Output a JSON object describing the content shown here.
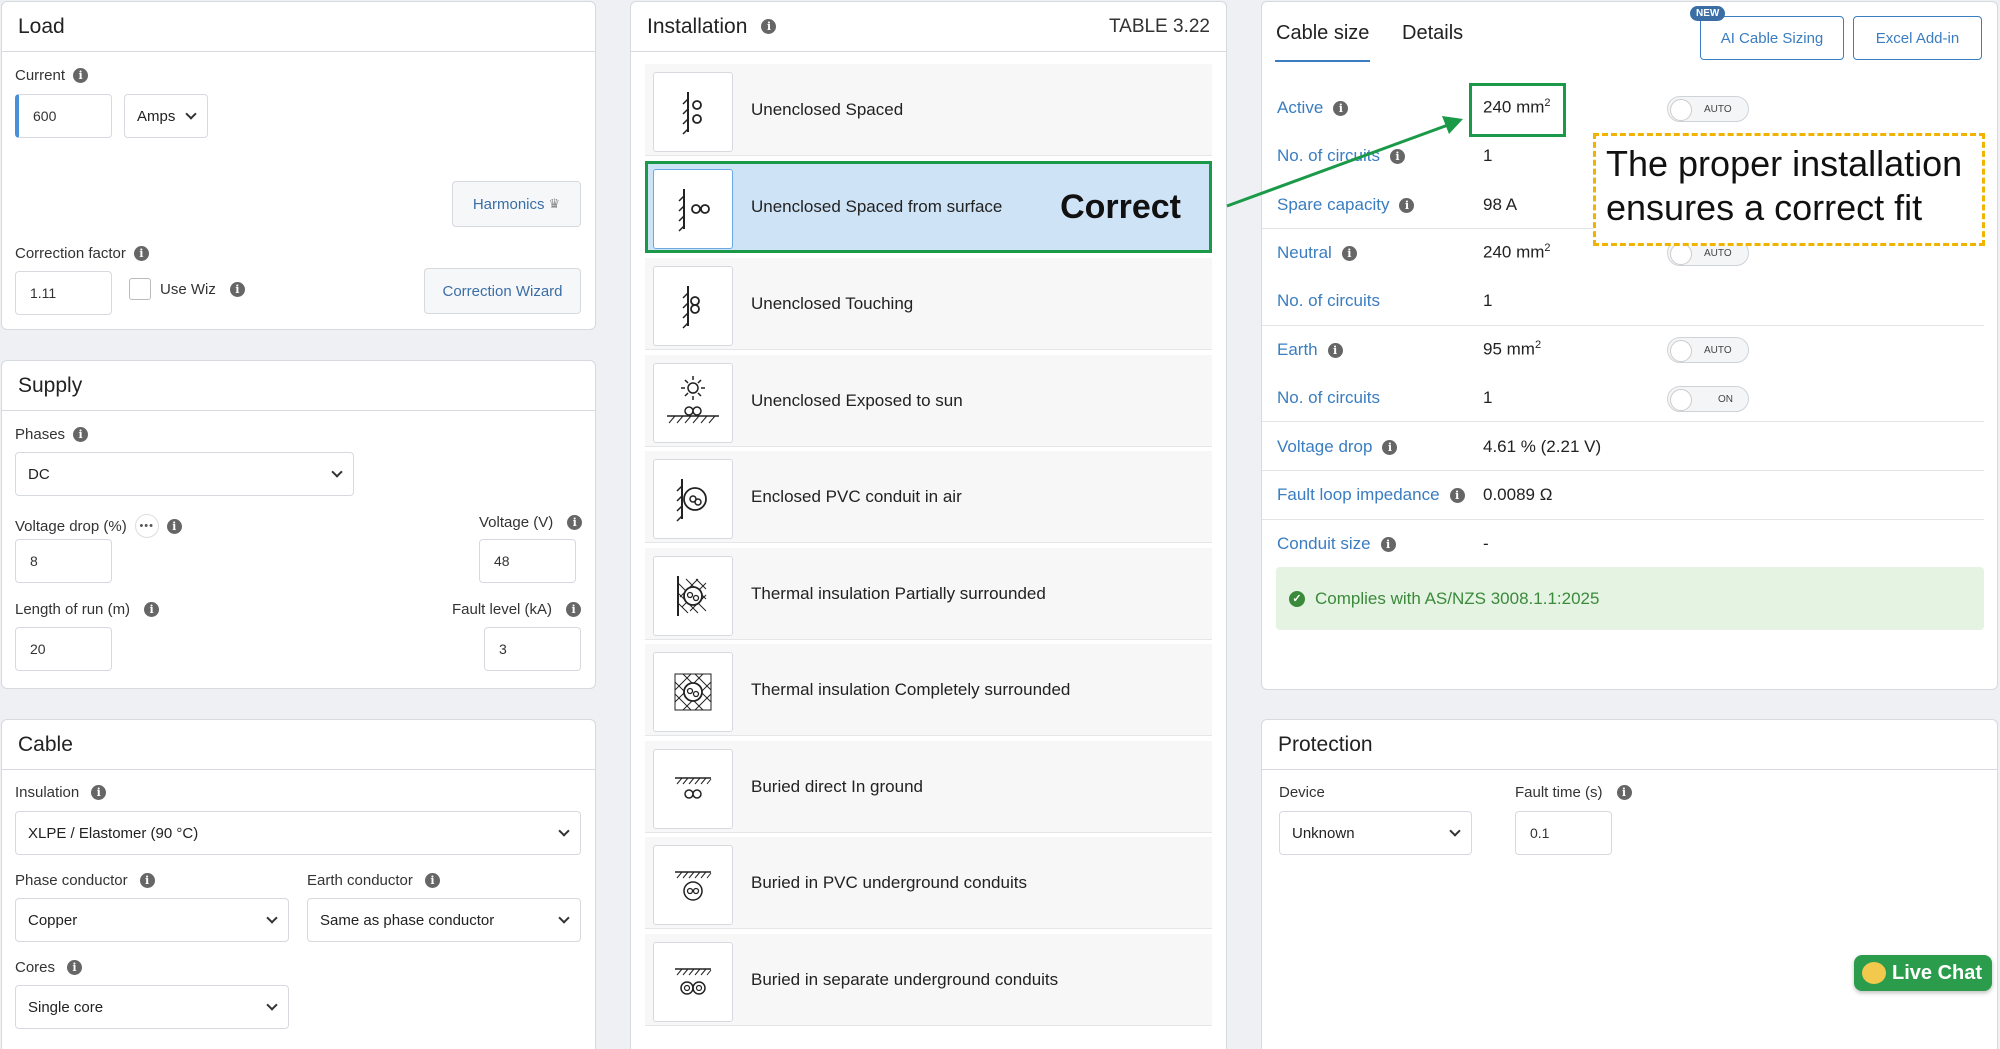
{
  "load": {
    "title": "Load",
    "current_label": "Current",
    "current_value": "600",
    "unit": "Amps",
    "harmonics_label": "Harmonics",
    "correction_factor_label": "Correction factor",
    "correction_factor_value": "1.11",
    "use_wiz_label": "Use Wiz",
    "correction_wizard_label": "Correction Wizard"
  },
  "supply": {
    "title": "Supply",
    "phases_label": "Phases",
    "phases_value": "DC",
    "voltage_drop_label": "Voltage drop (%)",
    "voltage_drop_more": "•••",
    "voltage_drop_value": "8",
    "voltage_label": "Voltage (V)",
    "voltage_value": "48",
    "length_label": "Length of run (m)",
    "length_value": "20",
    "fault_level_label": "Fault level (kA)",
    "fault_level_value": "3"
  },
  "cable": {
    "title": "Cable",
    "insulation_label": "Insulation",
    "insulation_value": "XLPE / Elastomer (90 °C)",
    "phase_conductor_label": "Phase conductor",
    "phase_conductor_value": "Copper",
    "earth_conductor_label": "Earth conductor",
    "earth_conductor_value": "Same as phase conductor",
    "cores_label": "Cores",
    "cores_value": "Single core"
  },
  "installation": {
    "title": "Installation",
    "table_ref": "TABLE 3.22",
    "items": [
      {
        "label": "Unenclosed Spaced"
      },
      {
        "label": "Unenclosed Spaced from surface"
      },
      {
        "label": "Unenclosed Touching"
      },
      {
        "label": "Unenclosed Exposed to sun"
      },
      {
        "label": "Enclosed PVC conduit in air"
      },
      {
        "label": "Thermal insulation Partially surrounded"
      },
      {
        "label": "Thermal insulation Completely surrounded"
      },
      {
        "label": "Buried direct In ground"
      },
      {
        "label": "Buried in PVC underground conduits"
      },
      {
        "label": "Buried in separate underground conduits"
      }
    ],
    "selected_index": 1
  },
  "results": {
    "tabs": [
      "Cable size",
      "Details"
    ],
    "new_badge": "NEW",
    "ai_button": "AI Cable Sizing",
    "excel_button": "Excel Add-in",
    "active_label": "Active",
    "active_value": "240 mm",
    "active_toggle": "AUTO",
    "circuits_label": "No. of circuits",
    "circuits_value": "1",
    "spare_label": "Spare capacity",
    "spare_value": "98 A",
    "neutral_label": "Neutral",
    "neutral_value": "240 mm",
    "neutral_toggle": "AUTO",
    "neutral_circuits_label": "No. of circuits",
    "neutral_circuits_value": "1",
    "earth_label": "Earth",
    "earth_value": "95 mm",
    "earth_toggle": "AUTO",
    "earth_circuits_label": "No. of circuits",
    "earth_circuits_value": "1",
    "earth_circuits_toggle": "ON",
    "vd_label": "Voltage drop",
    "vd_value": "4.61 % (2.21 V)",
    "fli_label": "Fault loop impedance",
    "fli_value": "0.0089 Ω",
    "conduit_label": "Conduit size",
    "conduit_value": "-",
    "complies_text": "Complies with AS/NZS 3008.1.1:2025",
    "superscript": "2"
  },
  "protection": {
    "title": "Protection",
    "device_label": "Device",
    "device_value": "Unknown",
    "fault_time_label": "Fault time (s)",
    "fault_time_value": "0.1"
  },
  "annotations": {
    "correct_label": "Correct",
    "note_line1": "The proper installation",
    "note_line2": "ensures a correct fit"
  },
  "live_chat": "Live Chat",
  "colors": {
    "accent_blue": "#3a7dc0",
    "annotation_green": "#1a9a48",
    "annotation_yellow": "#f0b400",
    "selected_bg": "#cfe3f6",
    "success_bg": "#e4f3e2",
    "success_text": "#3b8a3b"
  }
}
